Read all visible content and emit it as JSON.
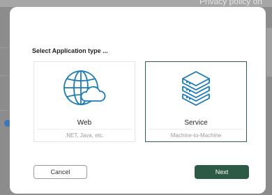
{
  "background": {
    "privacy_link": "Privacy policy on"
  },
  "dialog": {
    "heading": "Select Application type ...",
    "cards": [
      {
        "icon": "globe-cloud-icon",
        "title": "Web",
        "subtitle": ".NET, Java, etc.",
        "selected": false
      },
      {
        "icon": "server-stack-icon",
        "title": "Service",
        "subtitle": "Machine-to-Machine",
        "selected": true
      }
    ],
    "cancel_label": "Cancel",
    "next_label": "Next"
  },
  "colors": {
    "accent": "#2d5a45",
    "icon_blue": "#1b7bb8"
  }
}
